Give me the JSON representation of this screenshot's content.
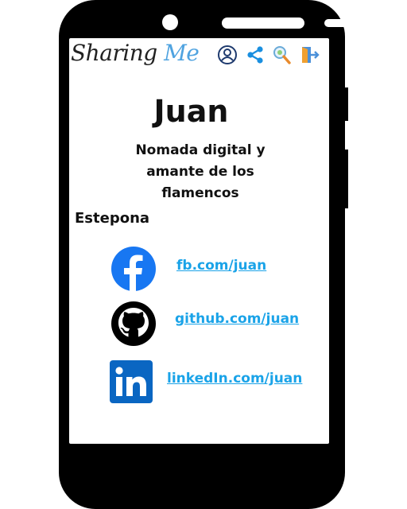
{
  "app": {
    "logo_part1": "Sharing",
    "logo_part2": "Me"
  },
  "toolbar": {
    "icons": [
      "profile-icon",
      "share-icon",
      "search-icon",
      "logout-icon"
    ]
  },
  "profile": {
    "name": "Juan",
    "bio_line1": "Nomada digital y",
    "bio_line2": "amante de los",
    "bio_line3": "flamencos",
    "location": "Estepona"
  },
  "links": [
    {
      "network": "facebook-icon",
      "label": "fb.com/juan",
      "color": "#1877f2"
    },
    {
      "network": "github-icon",
      "label": "github.com/juan",
      "color": "#000000"
    },
    {
      "network": "linkedin-icon",
      "label": "linkedIn.com/juan",
      "color": "#0a66c2"
    }
  ],
  "colors": {
    "link": "#1aa3e8",
    "logo_accent": "#4fa3e0",
    "phone_frame": "#000000"
  }
}
